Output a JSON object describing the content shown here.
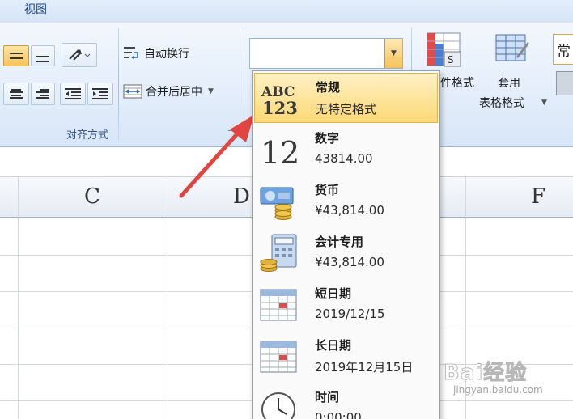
{
  "ribbon": {
    "tab_view": "视图",
    "wrap_text": "自动换行",
    "merge_center": "合并后居中",
    "alignment_group": "对齐方式",
    "number_format_value": "",
    "conditional_format": "件格式",
    "format_as_table_line1": "套用",
    "format_as_table_line2": "表格格式",
    "cell_style_preview": "常"
  },
  "columns": [
    "C",
    "D",
    "F"
  ],
  "format_menu": {
    "items": [
      {
        "name": "常规",
        "value": "无特定格式",
        "icon": "general-abc123-icon"
      },
      {
        "name": "数字",
        "value": "43814.00",
        "icon": "number-12-icon"
      },
      {
        "name": "货币",
        "value": "¥43,814.00",
        "icon": "currency-icon"
      },
      {
        "name": "会计专用",
        "value": " ¥43,814.00",
        "icon": "accounting-icon"
      },
      {
        "name": "短日期",
        "value": "2019/12/15",
        "icon": "calendar-icon"
      },
      {
        "name": "长日期",
        "value": "2019年12月15日",
        "icon": "calendar-icon"
      },
      {
        "name": "时间",
        "value": "0:00:00",
        "icon": "clock-icon"
      }
    ],
    "selected": "常规"
  },
  "watermark": {
    "brand": "Bai经验",
    "url": "jingyan.baidu.com"
  },
  "colors": {
    "highlight": "#fcd876",
    "arrow": "#e0453f",
    "ribbon": "#dfeaf8"
  }
}
